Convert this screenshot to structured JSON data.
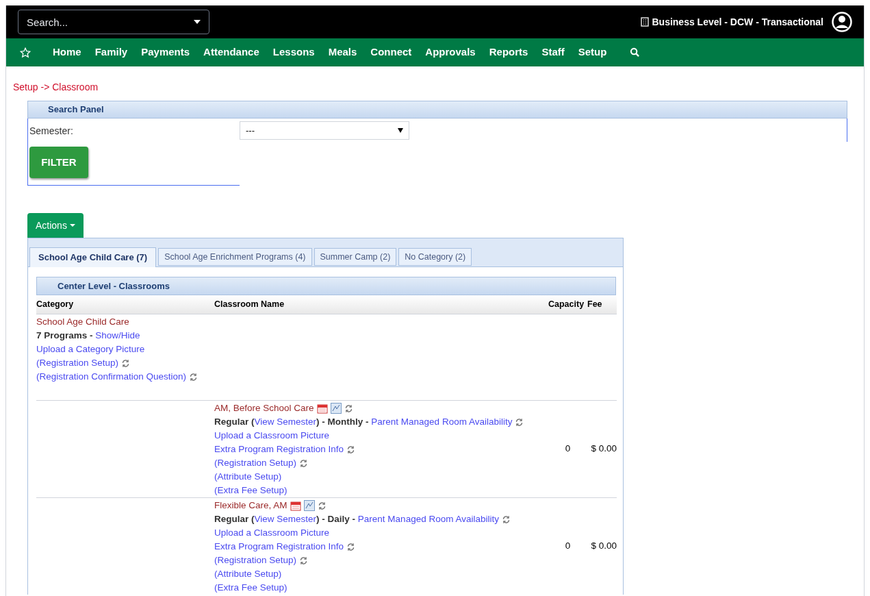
{
  "topbar": {
    "search_placeholder": "Search...",
    "business": "Business Level - DCW - Transactional"
  },
  "nav": {
    "items": [
      "Home",
      "Family",
      "Payments",
      "Attendance",
      "Lessons",
      "Meals",
      "Connect",
      "Approvals",
      "Reports",
      "Staff",
      "Setup"
    ]
  },
  "breadcrumb": "Setup -> Classroom",
  "search_panel": {
    "title": "Search Panel",
    "semester_label": "Semester:",
    "semester_value": "---",
    "filter_button": "FILTER"
  },
  "actions_button": "Actions",
  "tabs": [
    {
      "label": "School Age Child Care (7)",
      "selected": true
    },
    {
      "label": "School Age Enrichment Programs (4)",
      "selected": false
    },
    {
      "label": "Summer Camp (2)",
      "selected": false
    },
    {
      "label": "No Category (2)",
      "selected": false
    }
  ],
  "section_title": "Center Level - Classrooms",
  "table": {
    "columns": [
      "Category",
      "Classroom Name",
      "Capacity",
      "Fee"
    ],
    "category": {
      "name": "School Age Child Care",
      "count_text": "7 Programs -",
      "show_hide": "Show/Hide",
      "links": [
        {
          "text": "Upload a Category Picture",
          "refresh": false
        },
        {
          "text": "(Registration Setup)",
          "refresh": true
        },
        {
          "text": "(Registration Confirmation Question)",
          "refresh": true
        }
      ]
    },
    "programs": [
      {
        "name": "AM, Before School Care",
        "type_text": "Regular (",
        "semester_link": "View Semester",
        "billing_text": ") - Monthly -",
        "availability_link": "Parent Managed Room Availability",
        "links": [
          {
            "text": "Upload a Classroom Picture",
            "refresh": false
          },
          {
            "text": "Extra Program Registration Info",
            "refresh": true
          },
          {
            "text": "(Registration Setup)",
            "refresh": true
          },
          {
            "text": "(Attribute Setup)",
            "refresh": false
          },
          {
            "text": "(Extra Fee Setup)",
            "refresh": false
          }
        ],
        "capacity": "0",
        "fee": "$ 0.00"
      },
      {
        "name": "Flexible Care, AM",
        "type_text": "Regular (",
        "semester_link": "View Semester",
        "billing_text": ") - Daily -",
        "availability_link": "Parent Managed Room Availability",
        "links": [
          {
            "text": "Upload a Classroom Picture",
            "refresh": false
          },
          {
            "text": "Extra Program Registration Info",
            "refresh": true
          },
          {
            "text": "(Registration Setup)",
            "refresh": true
          },
          {
            "text": "(Attribute Setup)",
            "refresh": false
          },
          {
            "text": "(Extra Fee Setup)",
            "refresh": false
          }
        ],
        "capacity": "0",
        "fee": "$ 0.00"
      }
    ]
  }
}
